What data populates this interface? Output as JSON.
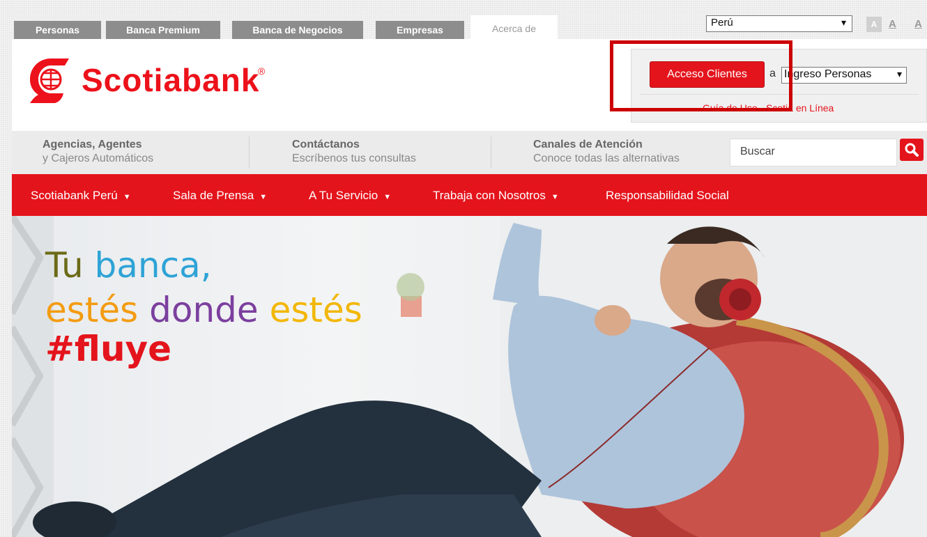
{
  "top_tabs": [
    "Personas",
    "Banca Premium",
    "Banca de Negocios",
    "Empresas",
    "Acerca de"
  ],
  "country_select": {
    "value": "Perú"
  },
  "font_size_controls": [
    "A",
    "A",
    "A"
  ],
  "logo": {
    "name": "Scotiabank",
    "reg": "®"
  },
  "login": {
    "button": "Acceso Clientes",
    "connector": "a",
    "select_value": "Ingreso Personas",
    "guide_link": "Guía de Uso - Scotia en Línea"
  },
  "info_bar": {
    "items": [
      {
        "title": "Agencias, Agentes",
        "subtitle": "y Cajeros Automáticos"
      },
      {
        "title": "Contáctanos",
        "subtitle": "Escríbenos tus consultas"
      },
      {
        "title": "Canales de Atención",
        "subtitle": "Conoce todas las alternativas"
      }
    ],
    "search_placeholder": "Buscar"
  },
  "nav": {
    "items": [
      {
        "label": "Scotiabank Perú",
        "dropdown": true
      },
      {
        "label": "Sala de Prensa",
        "dropdown": true
      },
      {
        "label": "A Tu Servicio",
        "dropdown": true
      },
      {
        "label": "Trabaja con Nosotros",
        "dropdown": true
      },
      {
        "label": "Responsabilidad Social",
        "dropdown": false
      }
    ]
  },
  "hero": {
    "line1": {
      "w1": "Tu",
      "w2": "banca,"
    },
    "line2": {
      "w1": "estés",
      "w2": "donde",
      "w3": "estés"
    },
    "line3": "#fluye"
  },
  "colors": {
    "brand_red": "#e4141c",
    "tab_gray": "#8d8d8d",
    "hero_olive": "#6b6b17",
    "hero_blue": "#2ea3d6",
    "hero_orange": "#f39c12",
    "hero_purple": "#7b3f9e",
    "hero_yellow": "#f2b707",
    "hero_red": "#e4141c"
  }
}
